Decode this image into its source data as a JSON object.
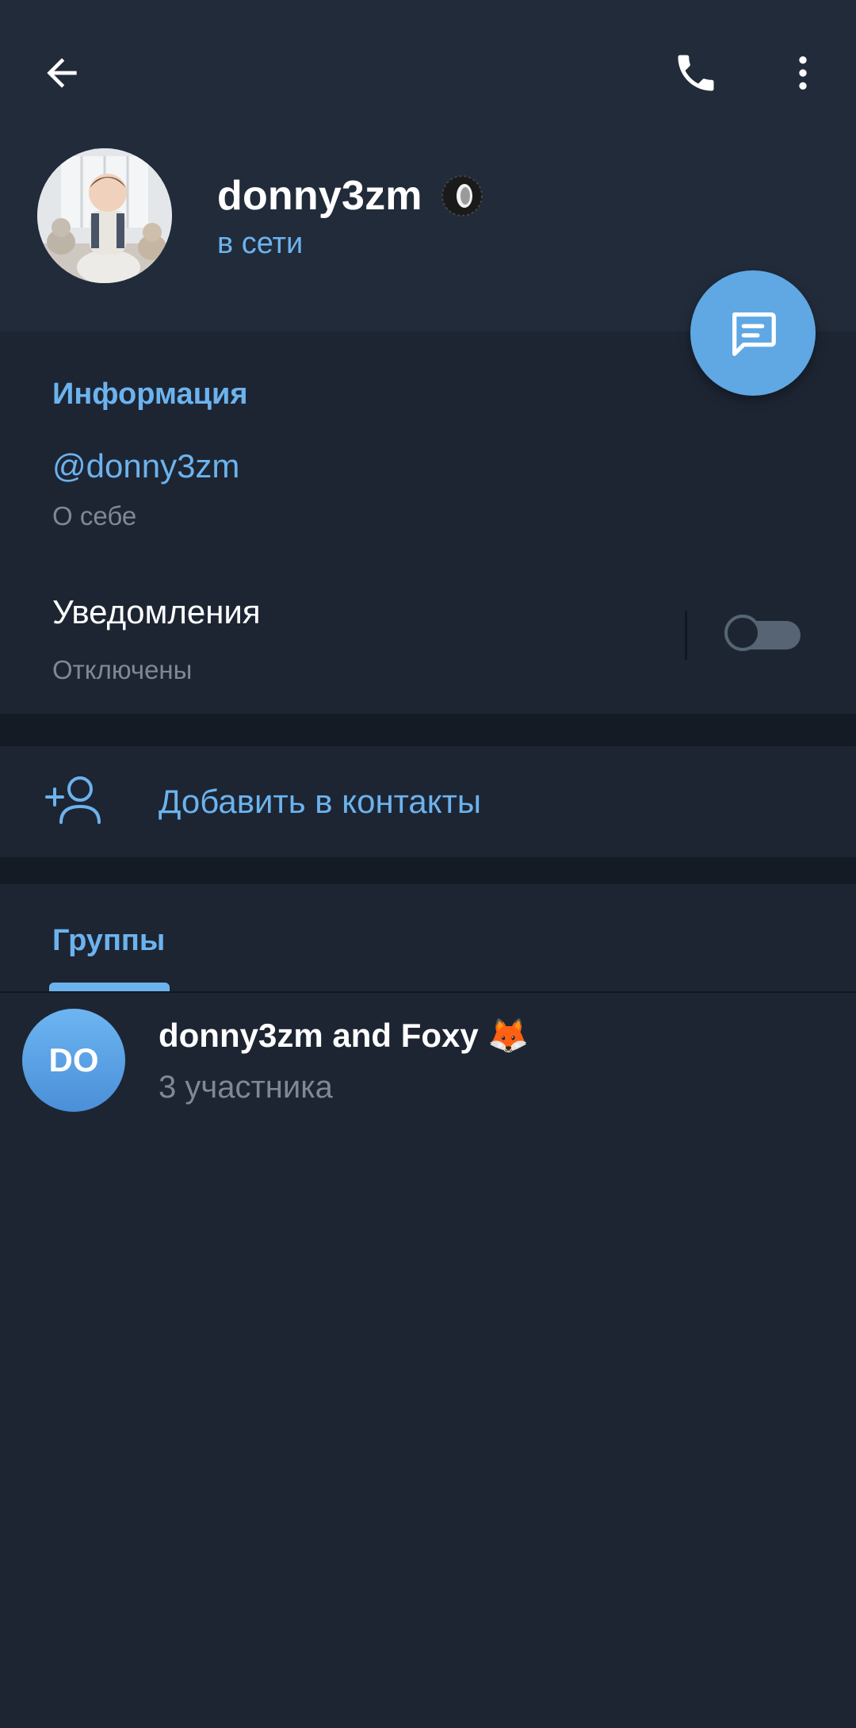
{
  "profile": {
    "name": "donny3zm",
    "status": "в сети",
    "emoji_status_icon": "tire-icon",
    "avatar_icon": "profile-photo"
  },
  "toolbar": {
    "back_icon": "arrow-left-icon",
    "call_icon": "phone-icon",
    "more_icon": "more-vertical-icon"
  },
  "fab": {
    "icon": "message-icon"
  },
  "info": {
    "section_title": "Информация",
    "username": "@donny3zm",
    "username_caption": "О себе",
    "notifications_title": "Уведомления",
    "notifications_caption": "Отключены",
    "notifications_enabled": false
  },
  "actions": {
    "add_contact_label": "Добавить в контакты",
    "add_contact_icon": "add-user-icon"
  },
  "groups": {
    "tab_label": "Группы",
    "items": [
      {
        "initials": "DO",
        "name": "donny3zm and Foxy 🦊",
        "subtitle": "3 участника"
      }
    ]
  },
  "colors": {
    "background": "#1d2533",
    "header": "#222b3a",
    "accent": "#6cb3ee",
    "fab": "#5fa8e4",
    "muted_text": "#7f8893"
  }
}
